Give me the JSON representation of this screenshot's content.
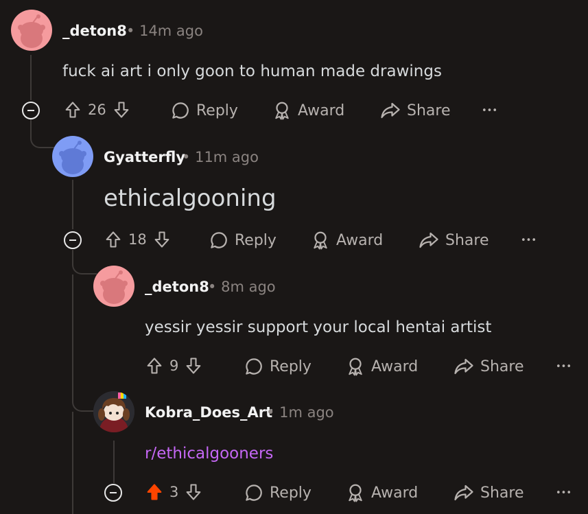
{
  "separator": "•",
  "labels": {
    "reply": "Reply",
    "award": "Award",
    "share": "Share",
    "more": "•••"
  },
  "colors": {
    "background": "#1a1716",
    "upvoted": "#ff4500",
    "link": "#c567f5",
    "avatar_pink": "#f59b9e",
    "avatar_blue": "#7f9cf5"
  },
  "comments": [
    {
      "author": "_deton8",
      "time": "14m ago",
      "body": "fuck ai art i only goon to human made drawings",
      "score": "26",
      "avatar_icon": "snoo-pink-avatar"
    },
    {
      "author": "Gyatterfly",
      "time": "11m ago",
      "body": "ethicalgooning",
      "score": "18",
      "avatar_icon": "snoo-blue-avatar"
    },
    {
      "author": "_deton8",
      "time": "8m ago",
      "body": "yessir yessir support your local hentai artist",
      "score": "9",
      "avatar_icon": "snoo-pink-avatar"
    },
    {
      "author": "Kobra_Does_Art",
      "time": "1m ago",
      "body": "r/ethicalgooners",
      "score": "3",
      "avatar_icon": "custom-character-avatar",
      "upvoted": true
    }
  ]
}
